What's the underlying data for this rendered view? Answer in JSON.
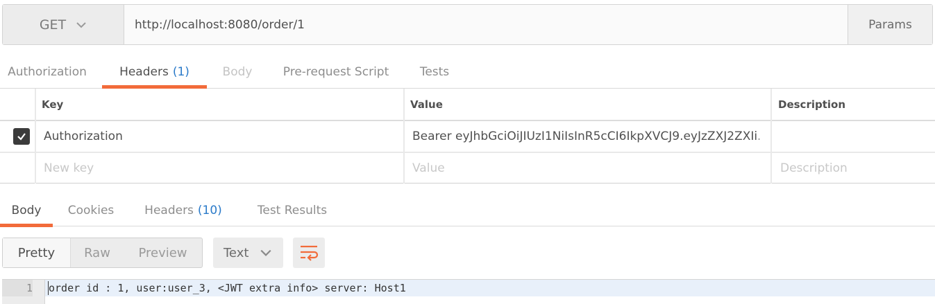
{
  "request": {
    "method": "GET",
    "url": "http://localhost:8080/order/1",
    "params_label": "Params"
  },
  "request_tabs": [
    {
      "label": "Authorization",
      "count": "",
      "state": "normal"
    },
    {
      "label": "Headers",
      "count": "(1)",
      "state": "active"
    },
    {
      "label": "Body",
      "count": "",
      "state": "disabled"
    },
    {
      "label": "Pre-request Script",
      "count": "",
      "state": "normal"
    },
    {
      "label": "Tests",
      "count": "",
      "state": "normal"
    }
  ],
  "headers_table": {
    "columns": [
      "Key",
      "Value",
      "Description"
    ],
    "rows": [
      {
        "checked": true,
        "key": "Authorization",
        "value": "Bearer eyJhbGciOiJIUzI1NiIsInR5cCI6IkpXVCJ9.eyJzZXJ2ZXIi…",
        "description": ""
      }
    ],
    "new_row": {
      "key_placeholder": "New key",
      "value_placeholder": "Value",
      "description_placeholder": "Description"
    }
  },
  "response_tabs": [
    {
      "label": "Body",
      "count": "",
      "state": "active"
    },
    {
      "label": "Cookies",
      "count": "",
      "state": "normal"
    },
    {
      "label": "Headers",
      "count": "(10)",
      "state": "normal"
    },
    {
      "label": "Test Results",
      "count": "",
      "state": "normal"
    }
  ],
  "response_toolbar": {
    "formats": [
      "Pretty",
      "Raw",
      "Preview"
    ],
    "active_format": "Pretty",
    "language": "Text",
    "wrap_icon": "wrap-lines-icon"
  },
  "response_body": {
    "lines": [
      {
        "number": "1",
        "text": "order id : 1, user:user_3, <JWT extra info> server: Host1"
      }
    ]
  },
  "colors": {
    "accent": "#f26b3a",
    "count": "#2a7ac9",
    "checkbox": "#3b3b3b"
  }
}
